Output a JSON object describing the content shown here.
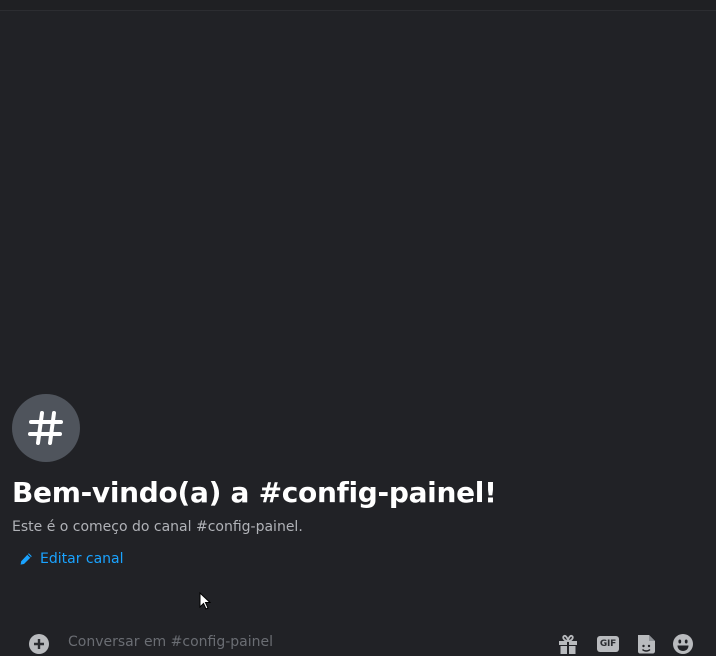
{
  "welcome": {
    "title": "Bem-vindo(a) a #config-painel!",
    "subtitle": "Este é o começo do canal #config-painel.",
    "edit_label": "Editar canal"
  },
  "composer": {
    "placeholder": "Conversar em #config-painel",
    "gif_label": "GIF"
  },
  "icons": {
    "channel_avatar": "hash-icon",
    "edit": "pencil-icon",
    "add": "plus-circle-icon",
    "gift": "gift-icon",
    "gif": "gif-icon",
    "sticker": "sticker-icon",
    "emoji": "emoji-icon"
  },
  "colors": {
    "background": "#212226",
    "link": "#1aa3ff",
    "avatar": "#4f545c",
    "icon": "#b9bbbe"
  }
}
